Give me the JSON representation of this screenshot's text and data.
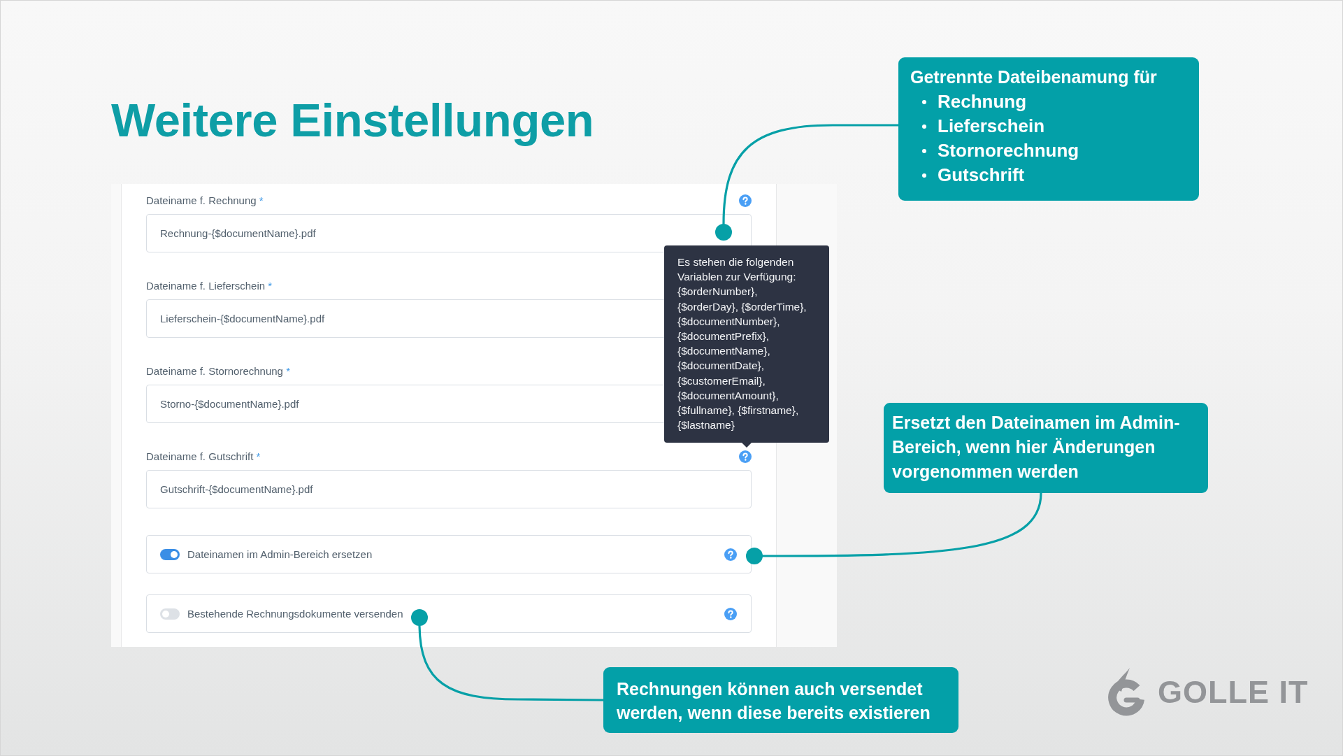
{
  "title": "Weitere Einstellungen",
  "fields": [
    {
      "label": "Dateiname f. Rechnung",
      "required_mark": "*",
      "value": "Rechnung-{$documentName}.pdf",
      "help": true
    },
    {
      "label": "Dateiname f. Lieferschein",
      "required_mark": "*",
      "value": "Lieferschein-{$documentName}.pdf"
    },
    {
      "label": "Dateiname f. Stornorechnung",
      "required_mark": "*",
      "value": "Storno-{$documentName}.pdf"
    },
    {
      "label": "Dateiname f. Gutschrift",
      "required_mark": "*",
      "value": "Gutschrift-{$documentName}.pdf",
      "help": true
    }
  ],
  "tooltip": {
    "text": "Es stehen die folgenden\nVariablen zur Verfügung:\n{$orderNumber},\n{$orderDay}, {$orderTime},\n{$documentNumber},\n{$documentPrefix},\n{$documentName},\n{$documentDate},\n{$customerEmail},\n{$documentAmount},\n{$fullname}, {$firstname},\n{$lastname}"
  },
  "toggles": [
    {
      "label": "Dateinamen im Admin-Bereich ersetzen",
      "on": true,
      "help": true
    },
    {
      "label": "Bestehende Rechnungsdokumente versenden",
      "on": false,
      "help": true
    }
  ],
  "callouts": [
    {
      "kind": "list",
      "title": "Getrennte Dateibenamung für",
      "items": [
        "Rechnung",
        "Lieferschein",
        "Stornorechnung",
        "Gutschrift"
      ]
    },
    {
      "kind": "text",
      "text": "Ersetzt den Dateinamen im Admin-Bereich, wenn hier Änderungen vorgenommen werden"
    },
    {
      "kind": "text",
      "text": "Rechnungen können auch versendet werden, wenn diese bereits existieren"
    }
  ],
  "logo": {
    "text": "GOLLE IT"
  }
}
